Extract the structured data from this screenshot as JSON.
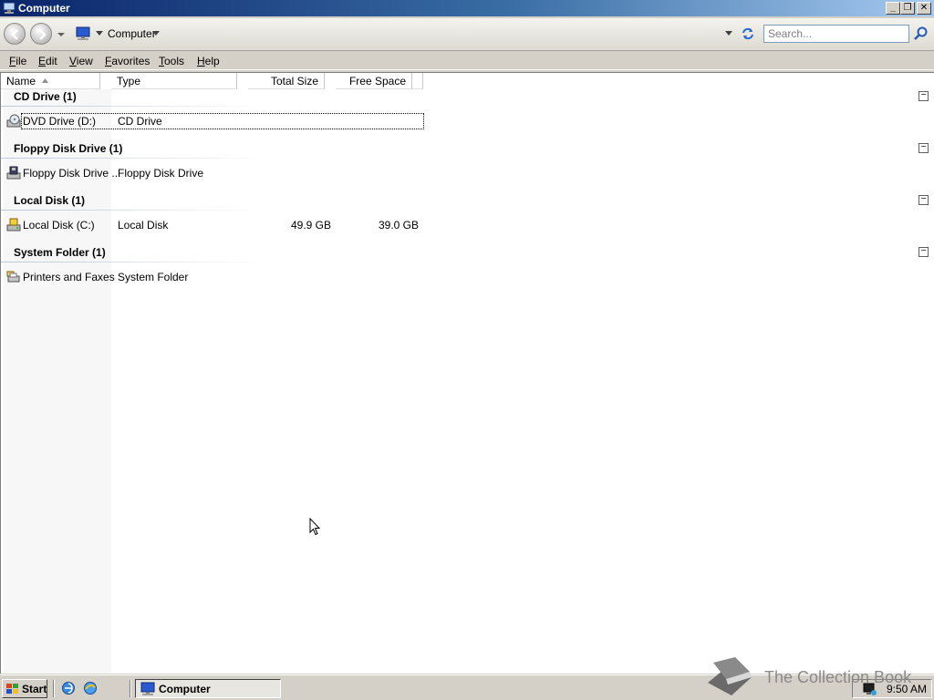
{
  "window": {
    "title": "Computer"
  },
  "navbar": {
    "address": "Computer",
    "search_placeholder": "Search..."
  },
  "menu": [
    {
      "label": "File"
    },
    {
      "label": "Edit"
    },
    {
      "label": "View"
    },
    {
      "label": "Favorites"
    },
    {
      "label": "Tools"
    },
    {
      "label": "Help"
    }
  ],
  "columns": {
    "name": "Name",
    "type": "Type",
    "total": "Total Size",
    "free": "Free Space"
  },
  "groups": [
    {
      "label": "CD Drive (1)",
      "item": {
        "name": "DVD Drive (D:)",
        "type": "CD Drive",
        "total": "",
        "free": "",
        "icon": "dvd-drive-icon"
      }
    },
    {
      "label": "Floppy Disk Drive (1)",
      "item": {
        "name": "Floppy Disk Drive ...",
        "type": "Floppy Disk Drive",
        "total": "",
        "free": "",
        "icon": "floppy-drive-icon"
      }
    },
    {
      "label": "Local Disk (1)",
      "item": {
        "name": "Local Disk (C:)",
        "type": "Local Disk",
        "total": "49.9 GB",
        "free": "39.0 GB",
        "icon": "local-disk-icon"
      }
    },
    {
      "label": "System Folder (1)",
      "item": {
        "name": "Printers and Faxes",
        "type": "System Folder",
        "total": "",
        "free": "",
        "icon": "printer-icon"
      }
    }
  ],
  "watermark": {
    "text": "The Collection Book"
  },
  "taskbar": {
    "start_label": "Start",
    "task_label": "Computer",
    "clock": "9:50 AM"
  }
}
